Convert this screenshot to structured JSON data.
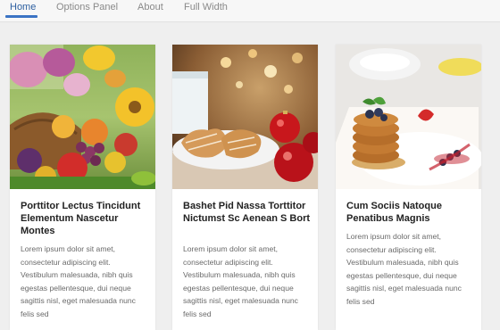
{
  "nav": {
    "items": [
      {
        "label": "Home",
        "active": true
      },
      {
        "label": "Options Panel",
        "active": false
      },
      {
        "label": "About",
        "active": false
      },
      {
        "label": "Full Width",
        "active": false
      }
    ],
    "accent_color": "#3b73c4"
  },
  "cards": [
    {
      "title": "Porttitor Lectus Tincidunt Elementum Nascetur Montes",
      "excerpt": "Lorem ipsum dolor sit amet, consectetur adipiscing elit. Vestibulum malesuada, nibh quis egestas pellentesque, dui neque sagittis nisl, eget malesuada nunc felis sed"
    },
    {
      "title": "Bashet Pid Nassa Torttitor Nictumst Sc Aenean S Bort",
      "excerpt": "Lorem ipsum dolor sit amet, consectetur adipiscing elit. Vestibulum malesuada, nibh quis egestas pellentesque, dui neque sagittis nisl, eget malesuada nunc felis sed"
    },
    {
      "title": "Cum Sociis Natoque Penatibus Magnis",
      "excerpt": "Lorem ipsum dolor sit amet, consectetur adipiscing elit. Vestibulum malesuada, nibh quis egestas pellentesque, dui neque sagittis nisl, eget malesuada nunc felis sed"
    }
  ]
}
